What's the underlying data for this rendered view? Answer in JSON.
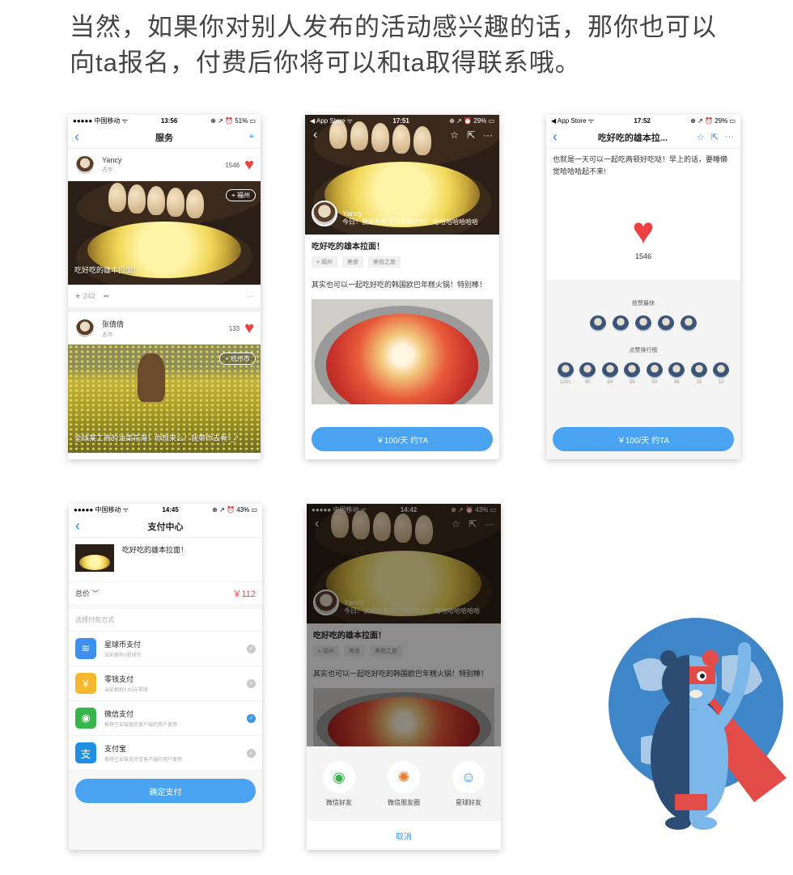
{
  "intro": {
    "line1": "当然，如果你对别人发布的活动感兴趣的话，那你也可以",
    "line2": "向ta报名，付费后你将可以和ta取得联系哦。"
  },
  "screen_feed": {
    "status": {
      "carrier": "●●●●● 中国移动 ᯤ",
      "time": "13:56",
      "battery": "⊕ ↗ ⏰ 51% ▭"
    },
    "nav_title": "服务",
    "posts": [
      {
        "name": "Yancy",
        "time": "去年",
        "likes": "1546",
        "location": "福州",
        "caption": "吃好吃的雄本拉面！",
        "stars": "242"
      },
      {
        "name": "张倩倩",
        "time": "去年",
        "likes": "133",
        "location": "杭州市",
        "caption": "全球某工商的油菜花海！你想来么！我带你去看^_^"
      }
    ]
  },
  "screen_detail": {
    "status": {
      "carrier": "◀ App Store ᯤ",
      "time": "17:51",
      "battery": "⊕ ↗ ⏰ 29% ▭"
    },
    "user": {
      "name": "Yancy",
      "message": "今日！就是你我签订契约之时！哈哈哈哈哈哈哈"
    },
    "title": "吃好吃的雄本拉面！",
    "tags": [
      "福州",
      "美食",
      "美拍之旅"
    ],
    "body": "其实也可以一起吃好吃的韩国欧巴年糕火锅！特别棒！",
    "cta": "￥100/天 约TA"
  },
  "screen_likes": {
    "status": {
      "carrier": "◀ App Store ᯤ",
      "time": "17:52",
      "battery": "⊕ ↗ ⏰ 29% ▭"
    },
    "nav_title": "吃好吃的雄本拉...",
    "body": "也就是一天可以一起吃两顿好吃哒！早上的话，要睡懒觉哈哈哈起不来!",
    "like_count": "1546",
    "fastest_label": "抢赞最快",
    "ranking_label": "点赞排行榜",
    "ranking_counts": [
      "1201",
      "90",
      "64",
      "56",
      "50",
      "48",
      "18",
      "10"
    ],
    "cta": "￥100/天 约TA"
  },
  "screen_pay": {
    "status": {
      "carrier": "●●●●● 中国移动 ᯤ",
      "time": "14:45",
      "battery": "⊕ ↗ ⏰ 43% ▭"
    },
    "nav_title": "支付中心",
    "item_title": "吃好吃的雄本拉面！",
    "total_label": "总价 ﹀",
    "total_value": "￥112",
    "method_label": "选择付款方式",
    "methods": [
      {
        "name": "星球币支付",
        "sub": "当前拥有0星球币",
        "color": "#3d8ff0",
        "icon": "≋"
      },
      {
        "name": "零钱支付",
        "sub": "当前拥有0.00元零钱",
        "color": "#f5b72e",
        "icon": "¥"
      },
      {
        "name": "微信支付",
        "sub": "推荐已安装微信客户端的用户使用",
        "color": "#35b54a",
        "icon": "◉"
      },
      {
        "name": "支付宝",
        "sub": "推荐已安装支付宝客户端的用户使用",
        "color": "#1f8fe6",
        "icon": "支"
      }
    ],
    "confirm": "确定支付"
  },
  "screen_share": {
    "status": {
      "carrier": "●●●●● 中国移动 ᯤ",
      "time": "14:42",
      "battery": "⊕ ↗ ⏰ 43% ▭"
    },
    "user": {
      "name": "Yancy",
      "message": "今日！就是你我签订契约之时！哈哈哈哈哈哈哈"
    },
    "title": "吃好吃的雄本拉面！",
    "tags": [
      "福州",
      "美食",
      "美拍之旅"
    ],
    "body": "其实也可以一起吃好吃的韩国欧巴年糕火锅！特别棒！",
    "share_targets": [
      {
        "label": "微信好友",
        "icon": "◉",
        "color": "#35b54a"
      },
      {
        "label": "微信朋友圈",
        "icon": "✺",
        "color": "#e6792c"
      },
      {
        "label": "星球好友",
        "icon": "☺",
        "color": "#3c96ee"
      }
    ],
    "cancel": "取消"
  },
  "colors": {
    "accent": "#4aa3f0",
    "heart": "#ee4040",
    "price": "#ee4040"
  }
}
